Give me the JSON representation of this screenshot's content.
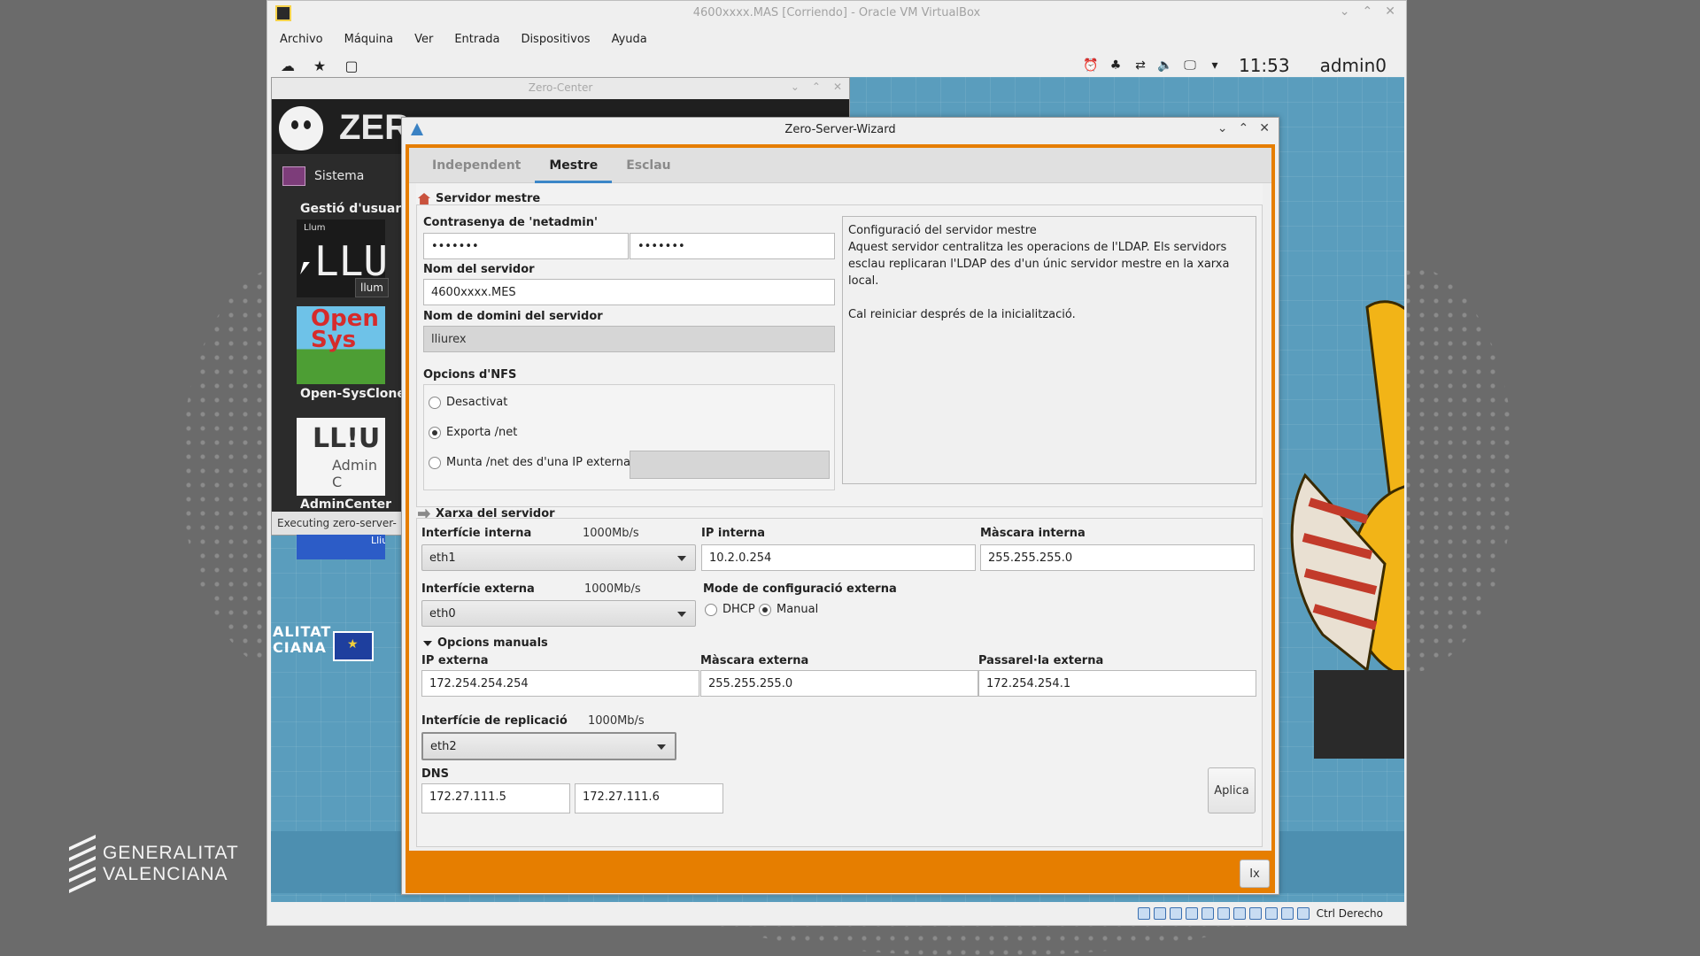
{
  "vbox": {
    "title": "4600xxxx.MAS [Corriendo] - Oracle VM VirtualBox",
    "menu": [
      "Archivo",
      "Máquina",
      "Ver",
      "Entrada",
      "Dispositivos",
      "Ayuda"
    ],
    "host_key": "Ctrl Derecho"
  },
  "host": {
    "logo_line1": "GENERALITAT",
    "logo_line2": "VALENCIANA"
  },
  "guest_panel": {
    "clock": "11:53",
    "user": "admin0"
  },
  "guest_desktop": {
    "gva_line1": "ALITAT",
    "gva_line2": "CIANA"
  },
  "zero_center": {
    "title": "Zero-Center",
    "logo_text": "ZER",
    "category": "Sistema",
    "tiles": [
      {
        "label": "Gestió d'usuaris",
        "art": "LLUM",
        "sub": "Llum"
      },
      {
        "label": "Open-SysClone",
        "art": "Open Sys"
      },
      {
        "label": "AdminCenter",
        "art": "LL!U",
        "sub": "Admin C"
      },
      {
        "label": "",
        "art": "Lliur"
      }
    ],
    "tooltip": "llum",
    "status": "Executing zero-server-"
  },
  "wizard": {
    "title": "Zero-Server-Wizard",
    "tabs": [
      "Independent",
      "Mestre",
      "Esclau"
    ],
    "active_tab": "Mestre",
    "master": {
      "section_title": "Servidor mestre",
      "password_label": "Contrasenya de 'netadmin'",
      "password1": "•••••••",
      "password2": "•••••••",
      "server_name_label": "Nom del servidor",
      "server_name": "4600xxxx.MES",
      "domain_label": "Nom de domini del servidor",
      "domain": "lliurex",
      "nfs_label": "Opcions d'NFS",
      "nfs_options": [
        "Desactivat",
        "Exporta /net",
        "Munta /net des d'una IP externa"
      ],
      "nfs_selected": 1,
      "info_line1": "Configuració del servidor mestre",
      "info_line2": "Aquest servidor centralitza les operacions de l'LDAP. Els servidors esclau replicaran l'LDAP des d'un únic servidor mestre en la xarxa local.",
      "info_line3": "Cal reiniciar després de la inicialització."
    },
    "network": {
      "section_title": "Xarxa del servidor",
      "internal_iface_label": "Interfície interna",
      "internal_iface_speed": "1000Mb/s",
      "internal_iface": "eth1",
      "internal_ip_label": "IP interna",
      "internal_ip": "10.2.0.254",
      "internal_mask_label": "Màscara interna",
      "internal_mask": "255.255.255.0",
      "external_iface_label": "Interfície externa",
      "external_iface_speed": "1000Mb/s",
      "external_iface": "eth0",
      "ext_mode_label": "Mode de configuració externa",
      "ext_mode_options": [
        "DHCP",
        "Manual"
      ],
      "ext_mode_selected": 1,
      "manual_options_label": "Opcions manuals",
      "external_ip_label": "IP externa",
      "external_ip": "172.254.254.254",
      "external_mask_label": "Màscara externa",
      "external_mask": "255.255.255.0",
      "gateway_label": "Passarel·la externa",
      "gateway": "172.254.254.1",
      "replication_iface_label": "Interfície de replicació",
      "replication_iface_speed": "1000Mb/s",
      "replication_iface": "eth2",
      "dns_label": "DNS",
      "dns1": "172.27.111.5",
      "dns2": "172.27.111.6",
      "apply_label": "Aplica"
    },
    "close_label": "Ix"
  }
}
